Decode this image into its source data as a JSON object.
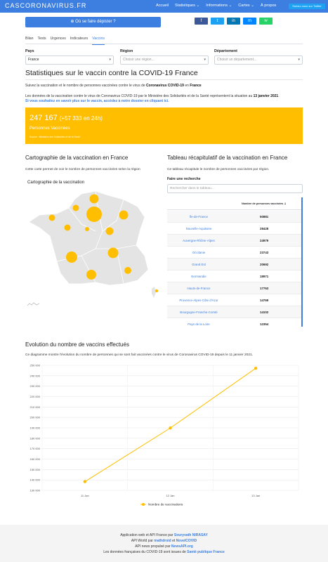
{
  "nav": {
    "brand": "CASCORONAVIRUS.FR",
    "links": [
      "Accueil",
      "Statistiques ⌄",
      "Informations ⌄",
      "Cartes ⌄",
      "À propos"
    ],
    "twitter_label": "Suivez-nous sur Twitter"
  },
  "depister_button": "⊕ Où se faire dépister ?",
  "share_buttons": [
    "f",
    "t",
    "in",
    "m",
    "w"
  ],
  "tabs": [
    "Bilan",
    "Tests",
    "Urgences",
    "Indicateurs",
    "Vaccins"
  ],
  "active_tab": "Vaccins",
  "filters": {
    "pays_label": "Pays",
    "pays_value": "France",
    "region_label": "Région",
    "region_placeholder": "Choisir une région...",
    "departement_label": "Département",
    "departement_placeholder": "Choisir un département..."
  },
  "title": "Statistiques sur le vaccin contre la COVID-19 France",
  "intro": {
    "p1_pre": "Suivez la vaccination et le nombre de personnes vaccinées contre le virus de ",
    "p1_b1": "Coronavirus COVID-19",
    "p1_mid": " en ",
    "p1_b2": "France",
    "p2_pre": "Les données de la vaccination contre le virus de Coronavirus COVID-19 par le Ministère des Solidarités et de la Santé représentent la situation au ",
    "p2_date": "13 janvier 2021",
    "p2_end": ".",
    "p3": "Si vous souhaitez en savoir plus sur le vaccin, accédez à notre dossier en cliquant ici."
  },
  "stat": {
    "total": "247 167",
    "delta": "(+57 333 en 24h)",
    "label": "Personnes Vaccinées",
    "source": "Source : Ministère des Solidarités et de la Santé"
  },
  "map_section": {
    "title": "Cartographie de la vaccination en France",
    "desc": "Cette carte permet de voir le nombre de personnes vaccinées selon la région",
    "card_title": "Cartographie de la vaccination",
    "accent": "#ffbf00"
  },
  "table_section": {
    "title": "Tableau récapitulatif de la vaccination en France",
    "desc": "Ce tableau récapitule le nombre de personnes vaccinées par région.",
    "search_label": "Faire une recherche",
    "search_placeholder": "Rechercher dans le tableau...",
    "col_header": "Nombre de personnes vaccinées ⇣",
    "rows": [
      {
        "region": "Île-de-France",
        "value": "50881"
      },
      {
        "region": "Nouvelle-Aquitaine",
        "value": "28428"
      },
      {
        "region": "Auvergne-Rhône-Alpes",
        "value": "24979"
      },
      {
        "region": "Occitanie",
        "value": "23743"
      },
      {
        "region": "Grand Est",
        "value": "20692"
      },
      {
        "region": "Normandie",
        "value": "18971"
      },
      {
        "region": "Hauts-de-France",
        "value": "17763"
      },
      {
        "region": "Provence-Alpes-Côte d'Azur",
        "value": "14769"
      },
      {
        "region": "Bourgogne-Franche-Comté",
        "value": "14102"
      },
      {
        "region": "Pays de la Loire",
        "value": "12354"
      }
    ]
  },
  "evolution": {
    "title": "Evolution du nombre de vaccins effectués",
    "desc": "Ce diagramme montre l'évolution du nombre de personnes qui se sont fait vaccinées contre le virus de Coronavirus COVID-19 depuis le 11 janvier 2021."
  },
  "chart_data": {
    "type": "line",
    "categories": [
      "11 Jan",
      "12 Jan",
      "13 Jan"
    ],
    "series": [
      {
        "name": "Nombre de vaccinations",
        "values": [
          138351,
          189834,
          247167
        ],
        "color": "#ffbf00"
      }
    ],
    "ylim": [
      130000,
      250000
    ],
    "yticks": [
      "130 000",
      "140 000",
      "150 000",
      "160 000",
      "170 000",
      "180 000",
      "190 000",
      "200 000",
      "210 000",
      "220 000",
      "230 000",
      "240 000",
      "250 000"
    ],
    "grid": true,
    "legend": "bottom"
  },
  "footer": {
    "l1_pre": "Application web et API France par ",
    "l1_b": "Souryvath NIRASAY",
    "l2_pre": "API World par ",
    "l2_b1": "mathdroid",
    "l2_mid": " et ",
    "l2_b2": "NovelCOVID",
    "l3_pre": "API news propulsé par ",
    "l3_b": "NewsAPI.org",
    "l4_pre": "Les données françaises du COVID-19 sont issues de ",
    "l4_b": "Santé publique France"
  }
}
